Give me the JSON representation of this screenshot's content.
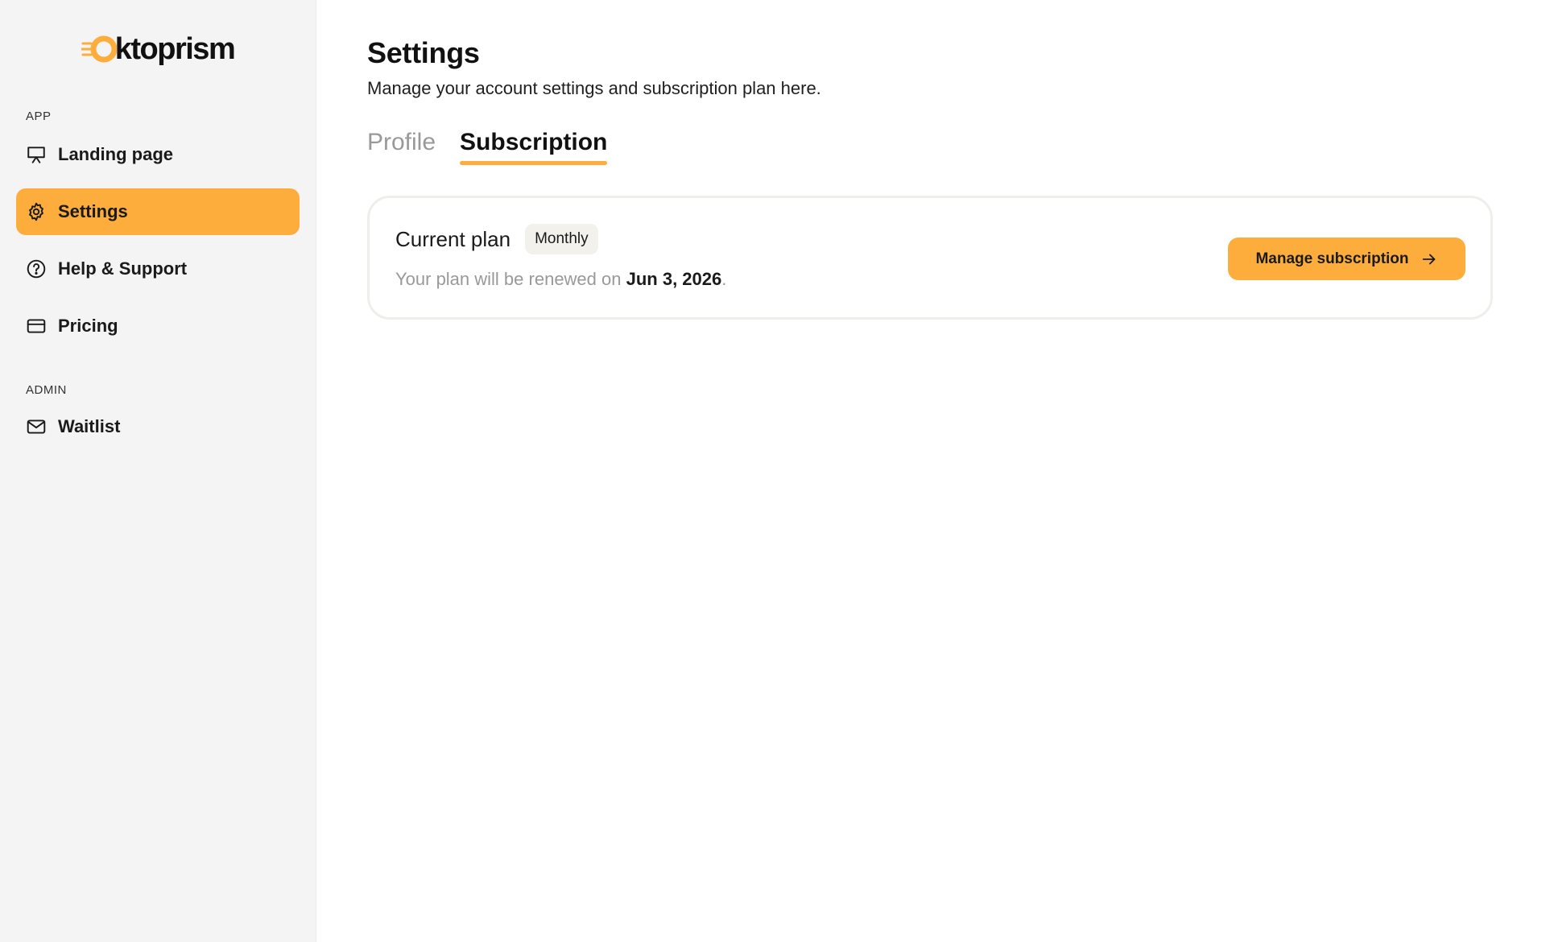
{
  "brand": {
    "name": "oktoprism",
    "logo_char": "O",
    "accent": "#fdad3c"
  },
  "sidebar": {
    "sections": [
      {
        "label": "APP",
        "items": [
          {
            "label": "Landing page",
            "icon": "presentation-icon",
            "active": false
          },
          {
            "label": "Settings",
            "icon": "gear-icon",
            "active": true
          },
          {
            "label": "Help & Support",
            "icon": "help-circle-icon",
            "active": false
          },
          {
            "label": "Pricing",
            "icon": "credit-card-icon",
            "active": false
          }
        ]
      },
      {
        "label": "ADMIN",
        "items": [
          {
            "label": "Waitlist",
            "icon": "mail-icon",
            "active": false
          }
        ]
      }
    ]
  },
  "header": {
    "title": "Settings",
    "subtitle": "Manage your account settings and subscription plan here."
  },
  "tabs": [
    {
      "label": "Profile",
      "active": false
    },
    {
      "label": "Subscription",
      "active": true
    }
  ],
  "subscription": {
    "title": "Current plan",
    "badge": "Monthly",
    "renew_prefix": "Your plan will be renewed on ",
    "renew_date": "Jun 3, 2026",
    "renew_suffix": ".",
    "manage_label": "Manage subscription",
    "manage_icon": "arrow-right-icon"
  }
}
